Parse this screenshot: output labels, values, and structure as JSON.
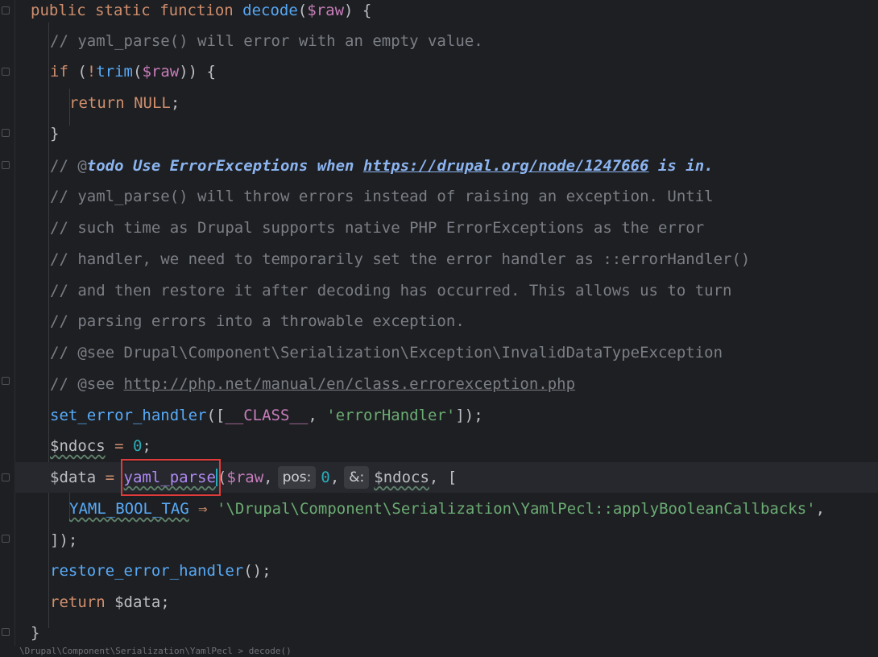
{
  "code": {
    "l1": {
      "kw1": "public",
      "kw2": "static",
      "kw3": "function",
      "fn": "decode",
      "open": "(",
      "var": "$raw",
      "close": ") {"
    },
    "l2": {
      "comment": "// yaml_parse() will error with an empty value."
    },
    "l3": {
      "kw": "if",
      "p1": " (",
      "bang": "!",
      "fn": "trim",
      "p2": "(",
      "var": "$raw",
      "p3": ")) {"
    },
    "l4": {
      "kw": "return",
      "const": "NULL",
      "semi": ";"
    },
    "l5": {
      "text": "}"
    },
    "l6": {
      "prefix": "// @",
      "todo": "todo Use ErrorExceptions when ",
      "link": "https://drupal.org/node/1247666",
      "suffix": " is in."
    },
    "l7": {
      "comment": "// yaml_parse() will throw errors instead of raising an exception. Until"
    },
    "l8": {
      "comment": "// such time as Drupal supports native PHP ErrorExceptions as the error"
    },
    "l9": {
      "comment": "// handler, we need to temporarily set the error handler as ::errorHandler()"
    },
    "l10": {
      "comment": "// and then restore it after decoding has occurred. This allows us to turn"
    },
    "l11": {
      "comment": "// parsing errors into a throwable exception."
    },
    "l12": {
      "comment": "// @see Drupal\\Component\\Serialization\\Exception\\InvalidDataTypeException"
    },
    "l13": {
      "prefix": "// @see ",
      "link": "http://php.net/manual/en/class.errorexception.php"
    },
    "l14": {
      "fn": "set_error_handler",
      "p1": "([",
      "const": "__CLASS__",
      "p2": ", ",
      "str": "'errorHandler'",
      "p3": "]);"
    },
    "l15": {
      "var": "$ndocs",
      "op": " = ",
      "num": "0",
      "semi": ";"
    },
    "l16": {
      "var": "$data",
      "op": " = ",
      "fn": "yaml_parse",
      "p1": "(",
      "arg1": "$raw",
      "comma1": ",",
      "hint1": "pos:",
      "num": "0",
      "comma2": ",",
      "hint2": "&:",
      "var2": "$ndocs",
      "p2": ", ["
    },
    "l17": {
      "const": "YAML_BOOL_TAG",
      "arrow": " ⇒ ",
      "str": "'\\Drupal\\Component\\Serialization\\YamlPecl::applyBooleanCallbacks'",
      "comma": ","
    },
    "l18": {
      "text": "]);"
    },
    "l19": {
      "fn": "restore_error_handler",
      "p": "();"
    },
    "l20": {
      "kw": "return",
      "var": " $data",
      "semi": ";"
    },
    "l21": {
      "text": "}"
    }
  },
  "footer": {
    "partial": "\\Drupal\\Component\\Serialization\\YamlPecl > decode()"
  },
  "colors": {
    "background": "#1e1f22",
    "keyword": "#cf8e6d",
    "function": "#56a8f5",
    "variable": "#c77dbb",
    "comment": "#7a7e85",
    "string": "#6aab73",
    "number": "#2aacb8",
    "selection": "#e03b3b"
  }
}
